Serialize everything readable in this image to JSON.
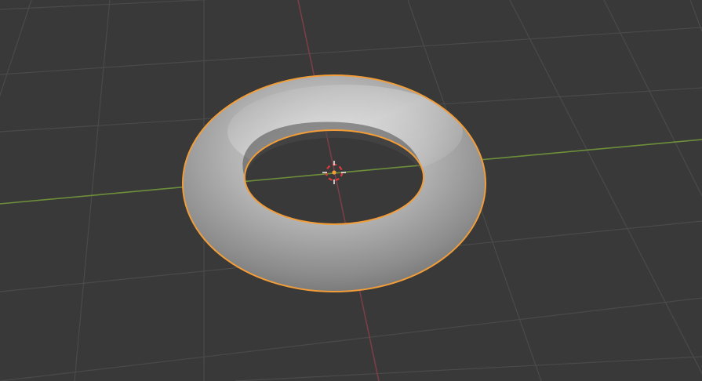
{
  "viewport": {
    "view": "perspective",
    "shading": "solid",
    "colors": {
      "background": "#393939",
      "grid_line": "#4a4a4a",
      "x_axis": "#7a3e48",
      "y_axis": "#6d8f3a",
      "selection_outline": "#f29d38",
      "object_light": "#c8c8c8",
      "object_shadow": "#555555",
      "cursor_red": "#e23a3a",
      "cursor_white": "#f2f2f2",
      "origin_dot": "#f29d38"
    }
  },
  "objects": [
    {
      "type": "torus",
      "selected": true,
      "active": true
    }
  ],
  "gizmos": {
    "cursor_icon": "3d-cursor-icon",
    "origin_icon": "object-origin-icon"
  }
}
